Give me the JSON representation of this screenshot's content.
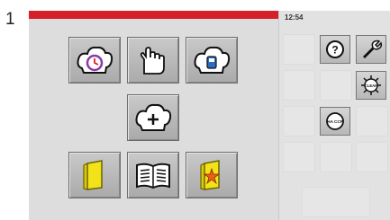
{
  "annotation": {
    "marker": "1"
  },
  "status": {
    "time": "12:54"
  },
  "side_panel": {
    "help_symbol": "?",
    "clean_label": "CLEAN",
    "haccp_label": "HA CCP"
  },
  "icons": {
    "row1": [
      "chef-hat-timer-icon",
      "hand-manual-icon",
      "chef-hat-probe-icon"
    ],
    "row2": [
      "chef-hat-add-icon"
    ],
    "row3": [
      "folder-icon",
      "cookbook-icon",
      "favorite-folder-icon"
    ],
    "side": [
      "help-icon",
      "wrench-icon",
      "clean-icon",
      "haccp-icon"
    ]
  },
  "colors": {
    "accent_red": "#d5202a",
    "folder_yellow": "#f2e21a",
    "timer_purple": "#8a3aa8",
    "probe_blue": "#2a6cc4"
  }
}
